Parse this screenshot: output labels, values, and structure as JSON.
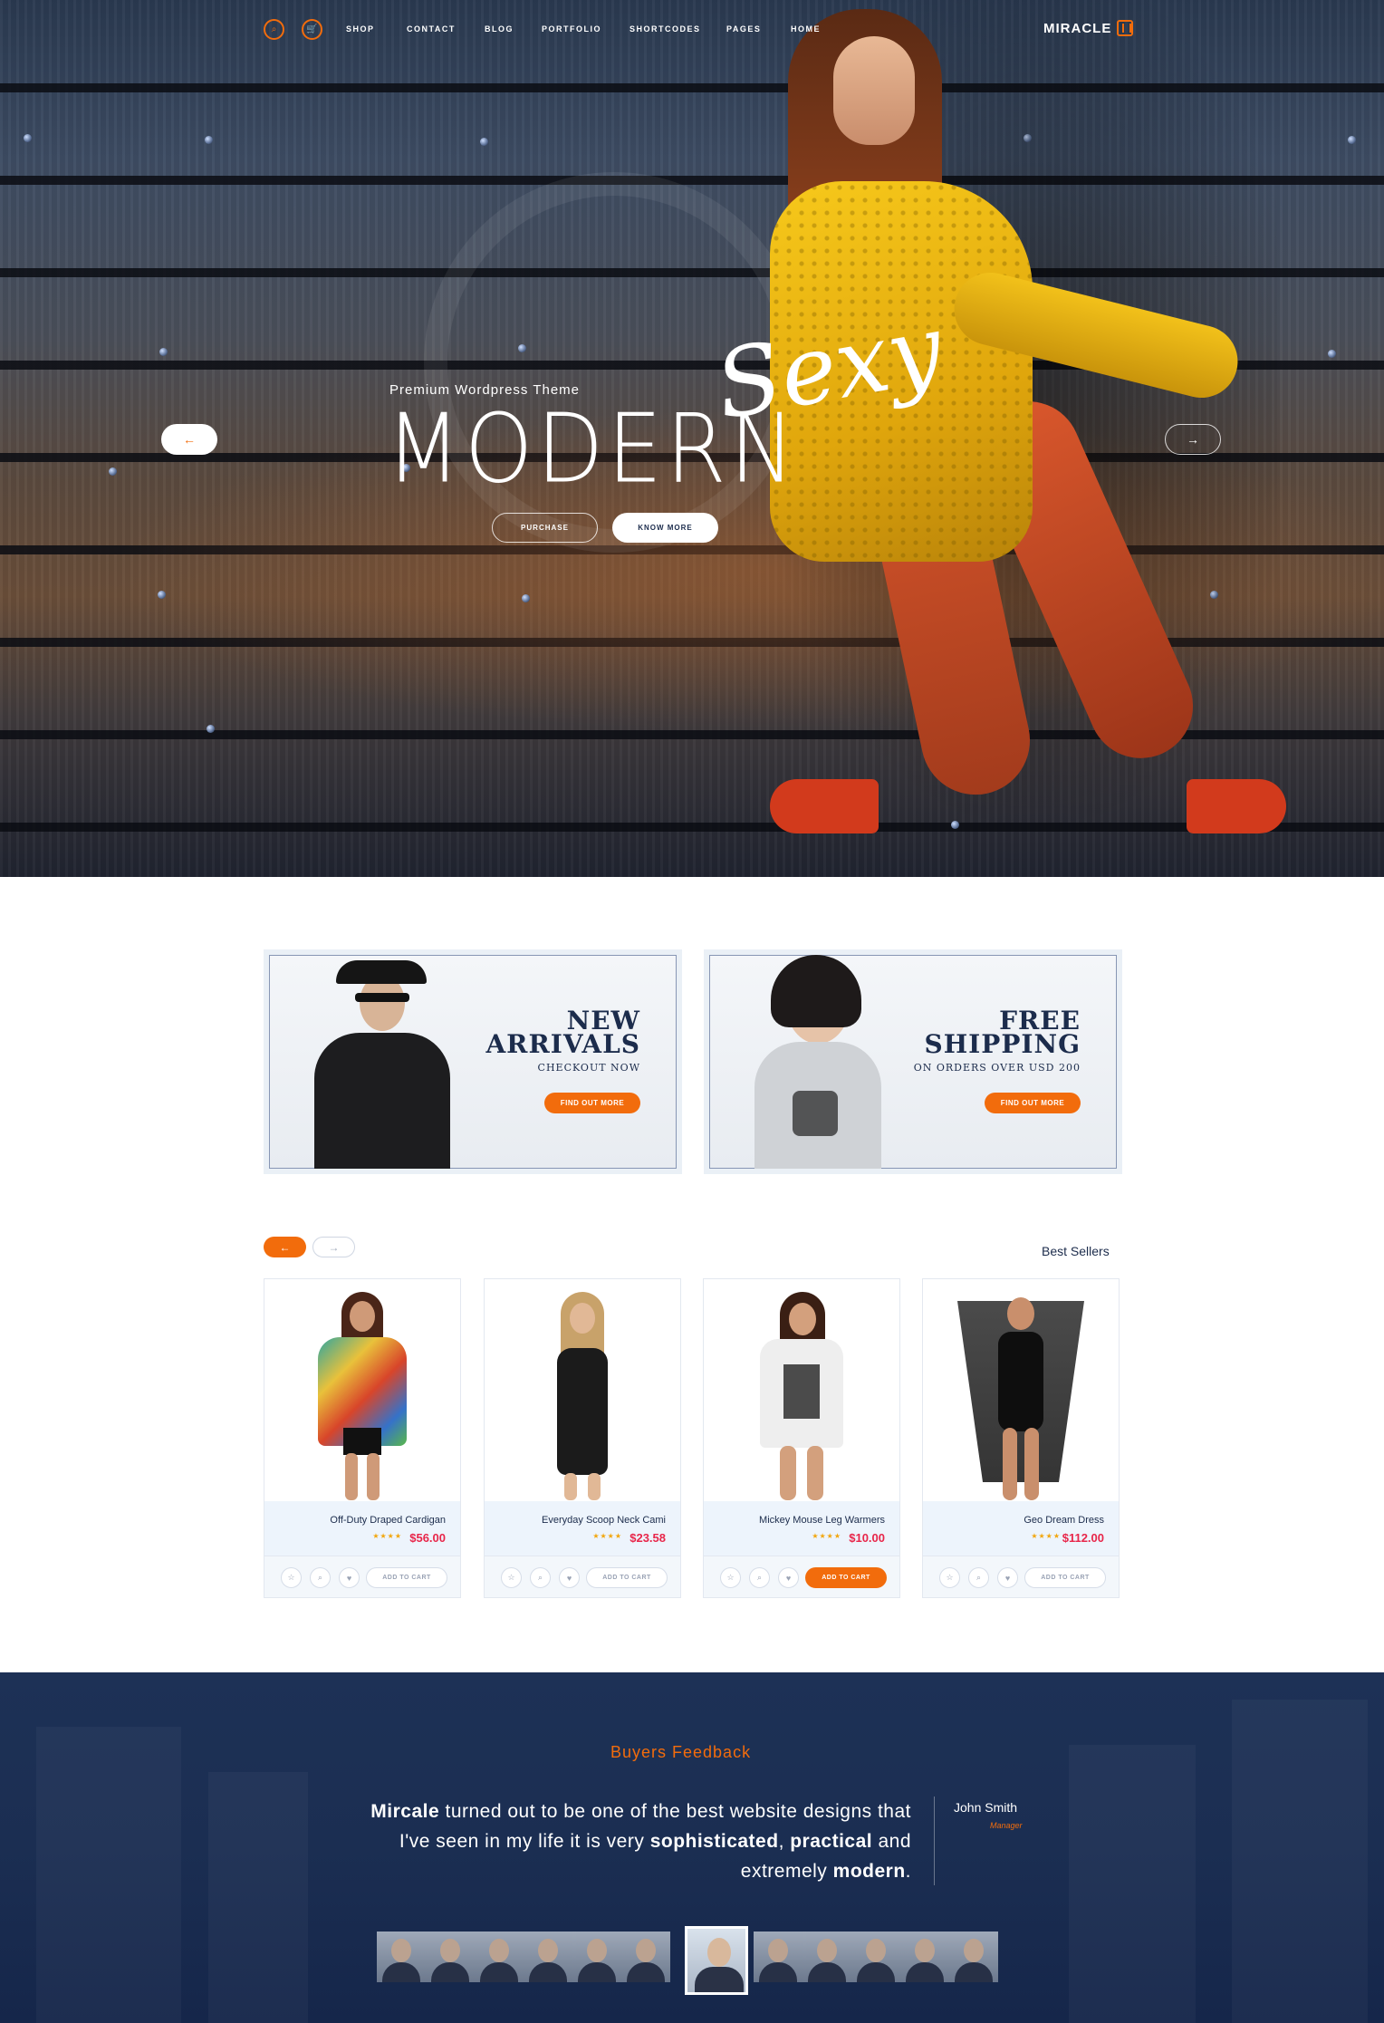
{
  "nav": {
    "logo": "MIRACLE",
    "menu": [
      "HOME",
      "PAGES",
      "SHORTCODES",
      "PORTFOLIO",
      "BLOG",
      "CONTACT",
      "SHOP"
    ],
    "cart_icon": "cart-icon",
    "search_icon": "search-icon"
  },
  "hero": {
    "subtitle": "Premium Wordpress Theme",
    "title": "MODERN",
    "script": "Sexy",
    "know_more": "KNOW MORE",
    "purchase": "PURCHASE",
    "prev_arrow": "←",
    "next_arrow": "→"
  },
  "promos": [
    {
      "headline_1": "FREE",
      "headline_2": "SHIPPING",
      "sub": "ON ORDERS OVER USD 200",
      "cta": "FIND OUT MORE"
    },
    {
      "headline_1": "NEW",
      "headline_2": "ARRIVALS",
      "sub": "CHECKOUT NOW",
      "cta": "FIND OUT MORE"
    }
  ],
  "best_sellers": {
    "title": "Best Sellers",
    "prev": "←",
    "next": "→",
    "products": [
      {
        "name": "Geo Dream Dress",
        "price": "$112.00",
        "stars": "★★★★",
        "add_label": "ADD TO CART",
        "active": false
      },
      {
        "name": "Mickey Mouse Leg Warmers",
        "price": "$10.00",
        "stars": "★★★★",
        "add_label": "ADD TO CART",
        "active": true
      },
      {
        "name": "Everyday Scoop Neck Cami",
        "price": "$23.58",
        "stars": "★★★★",
        "add_label": "ADD TO CART",
        "active": false
      },
      {
        "name": "Off-Duty Draped Cardigan",
        "price": "$56.00",
        "stars": "★★★★",
        "add_label": "ADD TO CART",
        "active": false
      }
    ]
  },
  "feedback": {
    "title": "Buyers Feedback",
    "quote_brand": "Mircale",
    "quote_1": " turned out to be one of the best website designs that I've seen in my life it is very ",
    "quote_word_1": "sophisticated",
    "quote_2": ", ",
    "quote_word_2": "practical",
    "quote_3": " and extremely ",
    "quote_word_3": "modern",
    "quote_4": ".",
    "author": "John Smith",
    "role": "Manager"
  },
  "colors": {
    "accent": "#f26c0c",
    "navy": "#1c2c4c",
    "price": "#e8264a"
  }
}
